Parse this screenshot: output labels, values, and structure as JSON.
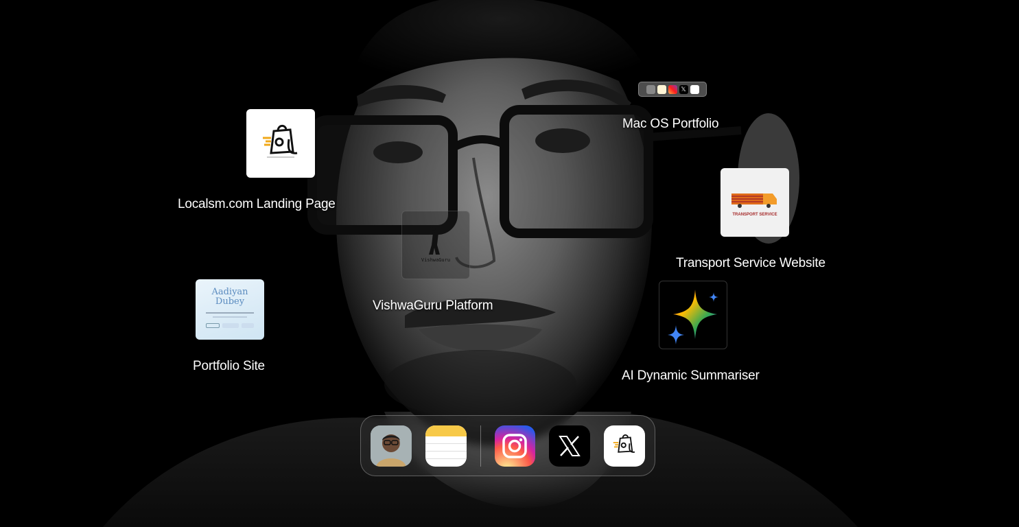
{
  "desktop": {
    "shortcuts": [
      {
        "id": "localsm",
        "label": "Localsm.com Landing Page",
        "icon": "localsm-bag-logo"
      },
      {
        "id": "macos",
        "label": "Mac OS Portfolio",
        "icon": "mini-dock-preview"
      },
      {
        "id": "transport",
        "label": "Transport Service Website",
        "icon": "truck-logo",
        "logo_text": "TRANSPORT SERVICE"
      },
      {
        "id": "vishwaguru",
        "label": "VishwaGuru Platform",
        "icon": "vishwaguru-logo",
        "logo_text": "VishwaGuru"
      },
      {
        "id": "portfolio",
        "label": "Portfolio Site",
        "icon": "portfolio-thumbnail",
        "thumb_title_1": "Aadiyan",
        "thumb_title_2": "Dubey"
      },
      {
        "id": "ai",
        "label": "AI Dynamic Summariser",
        "icon": "gemini-sparkle-icon"
      }
    ]
  },
  "dock": {
    "apps": [
      {
        "id": "photo",
        "icon": "profile-photo-icon"
      },
      {
        "id": "notes",
        "icon": "notes-icon"
      },
      {
        "id": "instagram",
        "icon": "instagram-icon"
      },
      {
        "id": "x",
        "icon": "x-icon"
      },
      {
        "id": "localsm",
        "icon": "localsm-bag-icon"
      }
    ]
  },
  "colors": {
    "background": "#000000",
    "label_text": "#ffffff",
    "transport_truck": "#e06b1a",
    "transport_text": "#a52a2a"
  }
}
